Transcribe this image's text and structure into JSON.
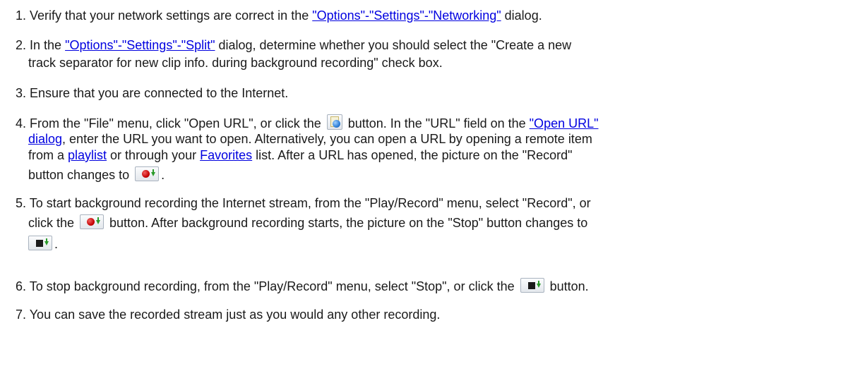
{
  "steps": [
    {
      "num": "1.",
      "a": "Verify that your network settings are correct in the ",
      "link": "\"Options\"-\"Settings\"-\"Networking\"",
      "b": " dialog."
    },
    {
      "num": "2.",
      "a": "In the ",
      "link": "\"Options\"-\"Settings\"-\"Split\"",
      "b": " dialog, determine whether you should select the \"Create a new",
      "line2": "track separator for new clip info. during background recording\" check box."
    },
    {
      "num": "3.",
      "text": "Ensure that you are connected to the Internet."
    },
    {
      "num": "4.",
      "l1a": "From the \"File\" menu, click \"Open URL\", or click the ",
      "l1b": " button. In the \"URL\" field on the ",
      "l1link": "\"Open URL\"",
      "l2link": "dialog",
      "l2b": ", enter the URL you want to open. Alternatively, you can open a URL by opening a remote item",
      "l3a": "from a ",
      "l3link1": "playlist",
      "l3b": " or through your ",
      "l3link2": "Favorites",
      "l3c": " list. After a URL has opened, the picture on the \"Record\"",
      "l4a": "button changes to ",
      "l4b": "."
    },
    {
      "num": "5.",
      "l1": "To start background recording the Internet stream, from the \"Play/Record\" menu, select \"Record\", or",
      "l2a": "click the ",
      "l2b": " button. After background recording starts, the picture on the \"Stop\" button changes to",
      "l3b": "."
    },
    {
      "num": "6.",
      "a": "To stop background recording, from the \"Play/Record\" menu, select \"Stop\", or click the ",
      "b": " button."
    },
    {
      "num": "7.",
      "text": "You can save the recorded stream just as you would any other recording."
    }
  ],
  "icons": {
    "open_url": "open-url-icon",
    "record": "record-icon",
    "stop": "stop-record-icon"
  }
}
